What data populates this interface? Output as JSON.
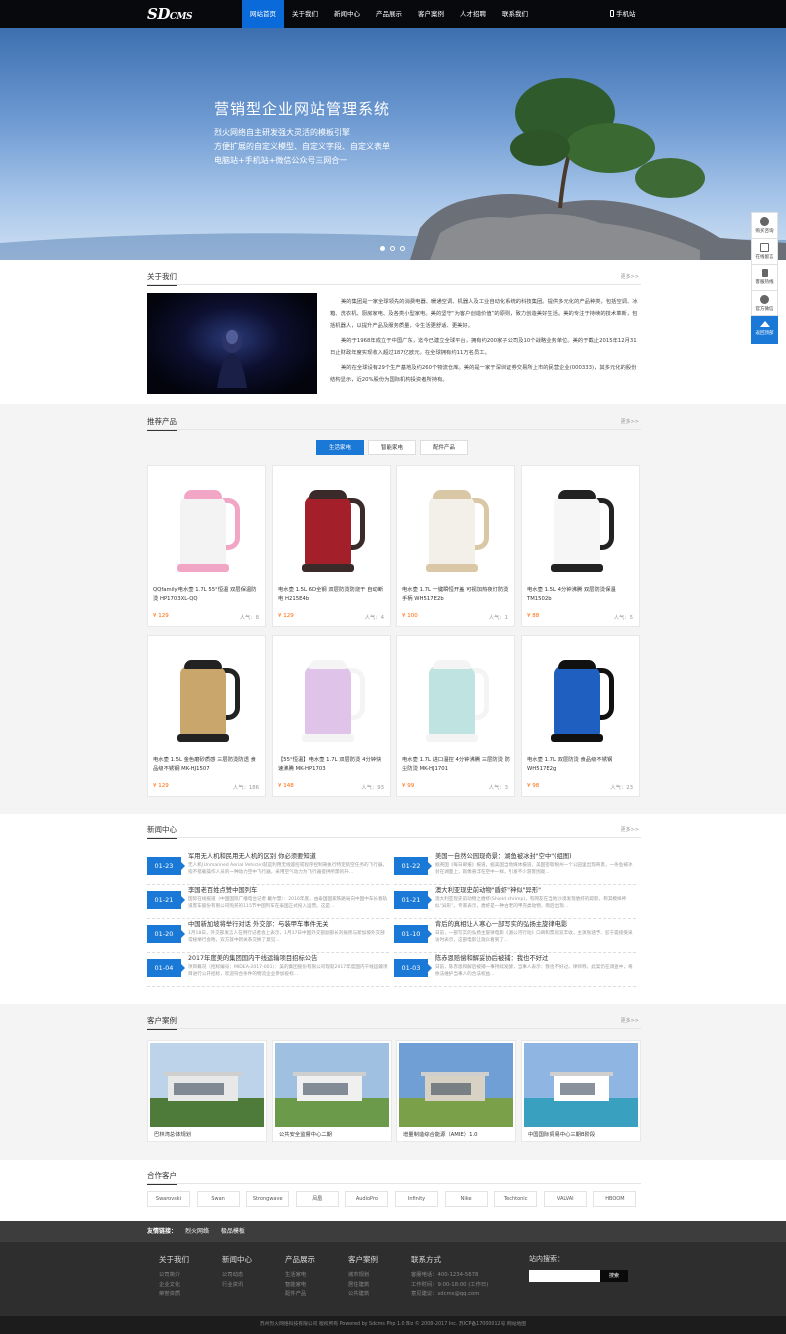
{
  "header": {
    "logo_main": "SD",
    "logo_sub": "CMS",
    "nav": [
      "网站首页",
      "关于我们",
      "新闻中心",
      "产品展示",
      "客户案例",
      "人才招聘",
      "联系我们"
    ],
    "mobile": "手机站"
  },
  "banner": {
    "title": "营销型企业网站管理系统",
    "lines": [
      "烈火网络自主研发强大灵活的模板引擎",
      "方便扩展的自定义模型、自定义字段、自定义表单",
      "电脑站+手机站+微信公众号三网合一"
    ]
  },
  "sidebar": {
    "items": [
      "购买咨询",
      "在线留言",
      "客服热线",
      "官方微信"
    ],
    "backtop": "返回顶部"
  },
  "about": {
    "title": "关于我们",
    "more": "更多>>",
    "paragraphs": [
      "美的集团是一家全球领先的消费电器、暖通空调、机器人及工业自动化系统的科技集团。提供多元化的产品种类，包括空调、冰箱、洗衣机、厨房家电、及各类小型家电。美的坚守“为客户创造价值”的原则，致力创造美好生活。美的专注于持续的技术革新，包括机器人，以提升产品及服务质量，令生活更舒适、更美好。",
      "美的于1968年成立于中国广东，迄今已建立全球平台，拥有约200家子公司及10个战略业务单位。美的于截止2015年12月31日止财政年度实现收入超过187亿欧元，在全球拥有约11万名员工。",
      "美的在全球设有29个生产基地及约260个物流仓库。美的是一家于深圳证券交易所上市的民营企业(000333)，其多元化的股份结构显示，近20%股份为国际机构投资者所持有。"
    ]
  },
  "products": {
    "title": "推荐产品",
    "more": "更多>>",
    "tabs": [
      "生活家电",
      "智能家电",
      "配件产品"
    ],
    "pop_label": "人气：",
    "items": [
      {
        "name": "QQfamily电水壶 1.7L 55°恒温 双层保温防烫 HP1703XL-QQ",
        "price": "¥ 129",
        "pop": "8",
        "color": "#f3f3f3",
        "accent": "#f2a6c6"
      },
      {
        "name": "电水壶 1.5L 6D全钢 双层防烫防烧干 自动断电 H215E4b",
        "price": "¥ 129",
        "pop": "4",
        "color": "#a3202a",
        "accent": "#3a2a2a"
      },
      {
        "name": "电水壶 1.7L 一键瞬恒开盖 可视加热夜灯防烫手柄 WH517E2b",
        "price": "¥ 100",
        "pop": "1",
        "color": "#f3f0ea",
        "accent": "#d9c7a6"
      },
      {
        "name": "电水壶 1.5L 4分钟沸腾 双层防烫保温 TM1502b",
        "price": "¥ 88",
        "pop": "5",
        "color": "#f6f6f6",
        "accent": "#222222"
      },
      {
        "name": "电水壶 1.5L 金色磨砂质感 三层防烫防透 食品级不锈钢 MK-HJ1507",
        "price": "¥ 129",
        "pop": "186",
        "color": "#c9a66b",
        "accent": "#222222"
      },
      {
        "name": "【55°恒温】电水壶 1.7L 双层防烫 4分钟快速沸腾 MK-HP1703",
        "price": "¥ 148",
        "pop": "93",
        "color": "#e0c3e8",
        "accent": "#f4f4f4"
      },
      {
        "name": "电水壶 1.7L 进口温控 4分钟沸腾 三层防烫 防尘防烫 MK-HJ1701",
        "price": "¥ 99",
        "pop": "3",
        "color": "#bfe3e0",
        "accent": "#f4f4f4"
      },
      {
        "name": "电水壶 1.7L 双层防烫 食品级不锈钢 WH517E2g",
        "price": "¥ 98",
        "pop": "23",
        "color": "#1f5fc0",
        "accent": "#111111"
      }
    ]
  },
  "news": {
    "title": "新闻中心",
    "more": "更多>>",
    "items": [
      {
        "date": "01-23",
        "title": "军用无人机和民用无人机的区别 你必须要知道",
        "desc": "无人机(Unmanned Aerial Vehicle)就是利用无线遥控或程序控制来执行特定航空任务的飞行器，指不搭载操作人员的一种动力空中飞行器，采用空气动力为飞行器提供所需的升..."
      },
      {
        "date": "01-22",
        "title": "美国一自然公园现奇景：湖鱼被冰封\"空中\"(组图)",
        "desc": "据英国《每日邮报》报道，据美国当地媒体报道，美国密歇根州一个公园里出现奇景，一条鱼被冰封在湖面上，就像悬浮在空中一样，引发不少游客围观..."
      },
      {
        "date": "01-21",
        "title": "李国老百姓点赞中国列车",
        "desc": "国际在线报道（中国国际广播电台记者 戴尔慧）：2016年底，由泰国国家铁路局向中国中车长春轨道客车股份有限公司购买的115节中国列车在泰国正式投入运营。这是..."
      },
      {
        "date": "01-21",
        "title": "澳大利亚现史前动物\"盾虾\"神似\"异形\"",
        "desc": "澳大利亚现史前动物之盾虾(Shield shrimp)，有网友在当地沙漠发现盾虾的踪影，称其模样神似“异形”。专家表示，盾虾是一种古老的甲壳类动物，雨后出现..."
      },
      {
        "date": "01-20",
        "title": "中国新加坡将举行对话 外交部：与装甲车事件无关",
        "desc": "1月18日，外交部发言人在例行记者会上表示，1月17日中国外交部副部长刘振民与新加坡外交部常秘举行会晤，双方就中新关系交换了意见..."
      },
      {
        "date": "01-10",
        "title": "背后的真相让人寒心一部写实的弘扬主旋律电影",
        "desc": "日前，一部写实的弘扬主旋律电影《湄公河行动》口碑和票房双丰收，主演张涵予、彭于晏接受采访时表示，这部电影让观众看到了..."
      },
      {
        "date": "01-04",
        "title": "2017年度美的集团国内干线运输项目招标公告",
        "desc": "项目概况（招标编号：MIDEA-2017-001）：美的集团股份有限公司现就2017年度国内干线运输项目进行公开招标，欢迎符合条件的物流企业参加投标..."
      },
      {
        "date": "01-03",
        "title": "陈赤恩赔偿和解妥协后被捕：我也不好过",
        "desc": "日前，陈赤恩和解后被捕一事持续发酵，当事人表示：我也不好过。律师称，此案仍在调查中，将依法维护当事人的合法权益..."
      }
    ]
  },
  "cases": {
    "title": "客户案例",
    "more": "更多>>",
    "items": [
      "巴林湾总体规划",
      "公共安全监督中心二期",
      "增量制造综合能源（AMIE）1.0",
      "中国国际贸易中心三期B阶段"
    ]
  },
  "partners": {
    "title": "合作客户",
    "items": [
      "Swarovski",
      "Swan",
      "Strongwave",
      "凤凰",
      "AudioPro",
      "Infinity",
      "Nike",
      "Techtonic",
      "VALVAI",
      "HBOOM"
    ]
  },
  "footer": {
    "links_label": "友情链接：",
    "links": [
      "烈火网络",
      "极品模板"
    ],
    "cols": [
      {
        "title": "关于我们",
        "items": [
          "公司简介",
          "企业文化",
          "荣誉资质"
        ]
      },
      {
        "title": "新闻中心",
        "items": [
          "公司动态",
          "行业资讯"
        ]
      },
      {
        "title": "产品展示",
        "items": [
          "生活家电",
          "智能家电",
          "配件产品"
        ]
      },
      {
        "title": "客户案例",
        "items": [
          "城市规划",
          "居住建筑",
          "公共建筑"
        ]
      },
      {
        "title": "联系方式",
        "items": [
          "客服电话：400-1234-5678",
          "工作时间：9:00-18:00 (工作日)",
          "意见建议：sdcms@qq.com"
        ]
      }
    ],
    "search_label": "站内搜索：",
    "search_placeholder": "",
    "search_button": "搜索",
    "copyright": "苏州烈火网络科技有限公司  版权所有  Powered by Sdcms Php 1.0 Biz © 2008-2017 Inc.  苏ICP备17000012号  网站地图"
  }
}
